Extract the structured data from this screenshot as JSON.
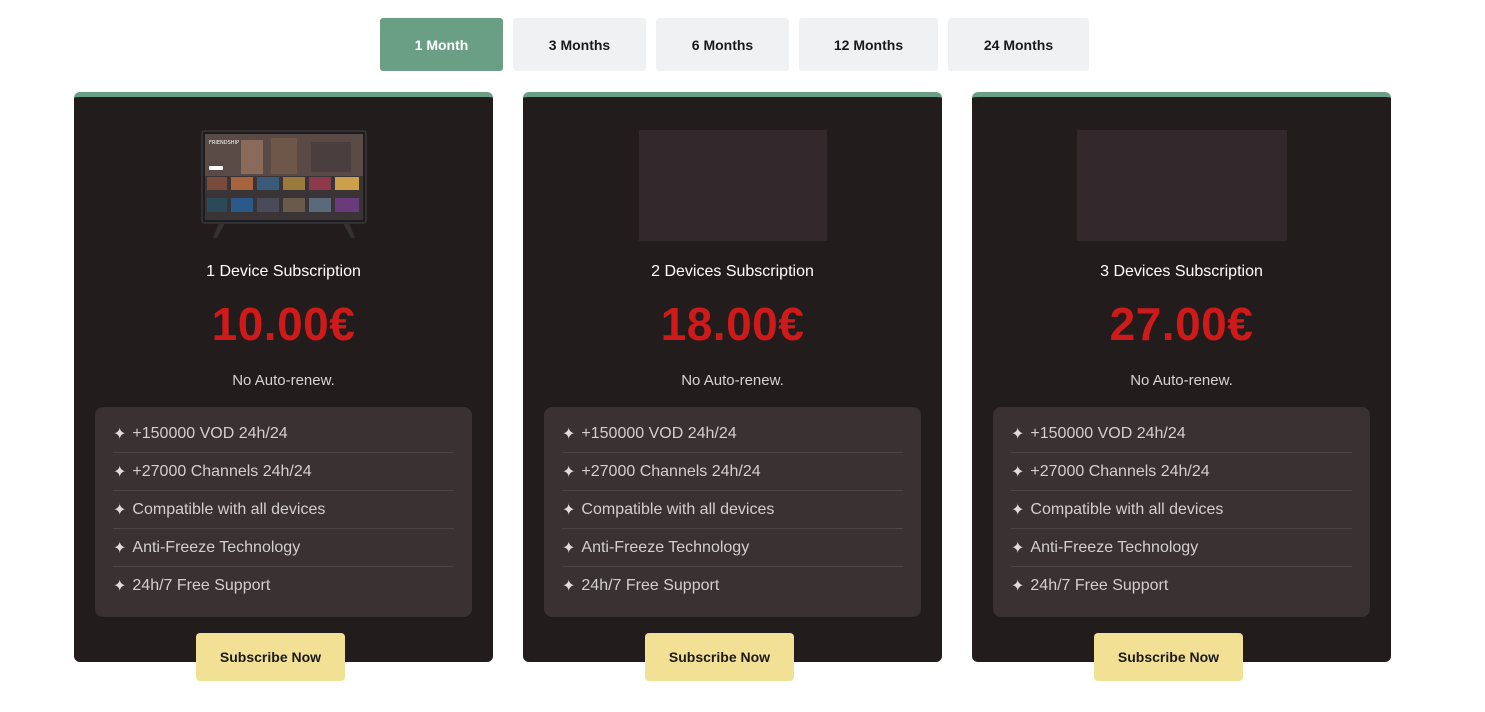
{
  "tabs": [
    {
      "label": "1 Month",
      "active": true
    },
    {
      "label": "3 Months",
      "active": false
    },
    {
      "label": "6 Months",
      "active": false
    },
    {
      "label": "12 Months",
      "active": false
    },
    {
      "label": "24 Months",
      "active": false
    }
  ],
  "plans": [
    {
      "title": "1 Device Subscription",
      "price": "10.00€",
      "renew": "No Auto-renew.",
      "button": "Subscribe Now",
      "tv_screen_text": "FRIENDSHIP"
    },
    {
      "title": "2 Devices Subscription",
      "price": "18.00€",
      "renew": "No Auto-renew.",
      "button": "Subscribe Now"
    },
    {
      "title": "3 Devices Subscription",
      "price": "27.00€",
      "renew": "No Auto-renew.",
      "button": "Subscribe Now"
    }
  ],
  "features": [
    "+150000 VOD 24h/24",
    "+27000 Channels 24h/24",
    "Compatible with all devices",
    "Anti-Freeze Technology",
    "24h/7 Free Support"
  ],
  "feature_bullet_icon": "four-point-star-icon",
  "colors": {
    "accent": "#6a9e85",
    "price": "#cf1a1a",
    "card_bg": "#231c1d",
    "button_bg": "#f2e194"
  }
}
